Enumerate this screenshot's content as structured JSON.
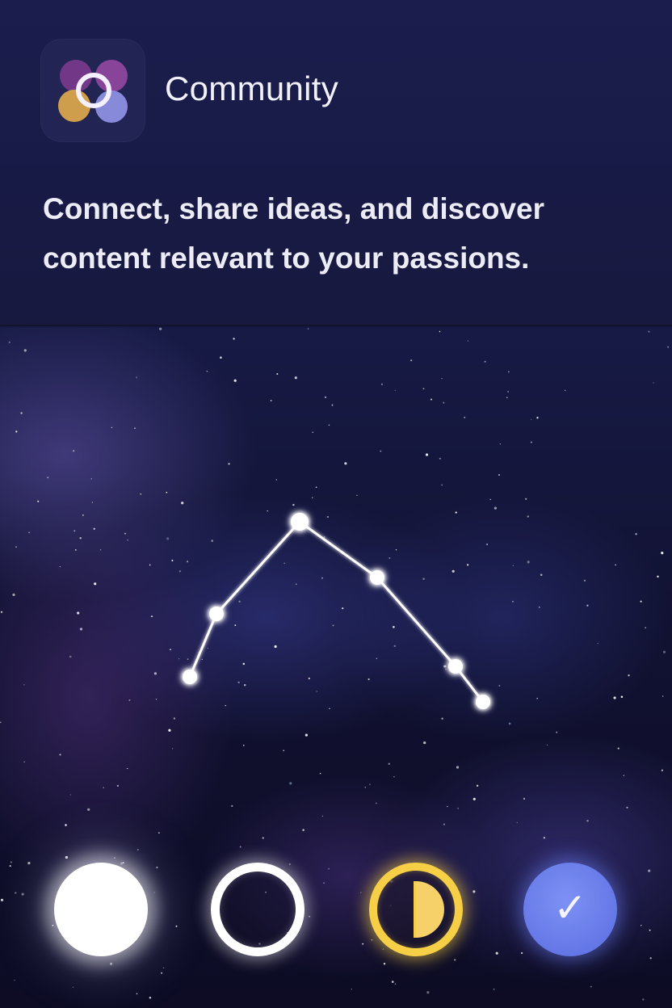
{
  "app": {
    "title": "Community",
    "description": "Connect, share ideas, and discover content relevant to your passions.",
    "icon": "community-logo-icon"
  },
  "controls": [
    {
      "name": "full-moon-button",
      "icon": "full-circle-icon"
    },
    {
      "name": "ring-button",
      "icon": "ring-icon"
    },
    {
      "name": "half-moon-button",
      "icon": "half-moon-icon",
      "color": "#f7cf47"
    },
    {
      "name": "confirm-button",
      "icon": "check-icon",
      "glyph": "✓",
      "color": "#6477e6"
    }
  ],
  "colors": {
    "header_bg": "#1b1d4d",
    "sky_bg": "#111232",
    "accent_yellow": "#f7cf47",
    "accent_blue": "#6477e6",
    "text": "#ececf6"
  }
}
